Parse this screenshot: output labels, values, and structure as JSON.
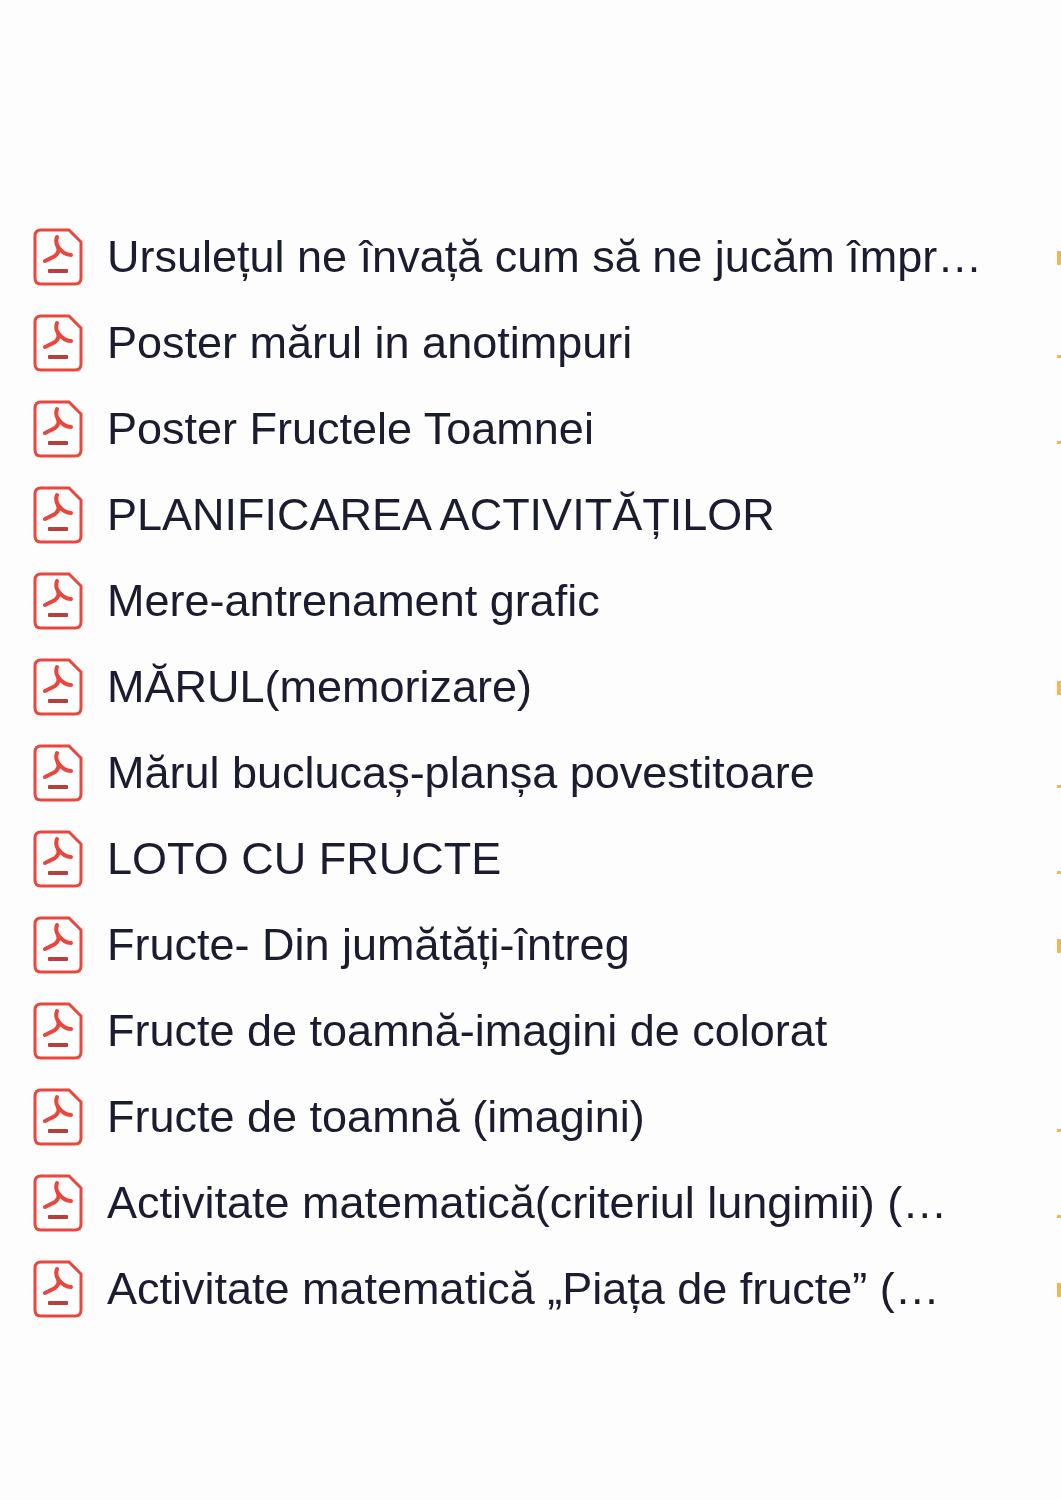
{
  "files": [
    {
      "name": "Ursulețul ne învață cum să ne jucăm împr…",
      "edge_mark": {
        "kind": "bar"
      }
    },
    {
      "name": "Poster mărul in anotimpuri",
      "edge_mark": {
        "kind": "dash"
      }
    },
    {
      "name": "Poster Fructele Toamnei",
      "edge_mark": {
        "kind": "dash"
      }
    },
    {
      "name": "PLANIFICAREA ACTIVITĂȚILOR"
    },
    {
      "name": "Mere-antrenament grafic"
    },
    {
      "name": "MĂRUL(memorizare)",
      "edge_mark": {
        "kind": "bar"
      }
    },
    {
      "name": "Mărul buclucaș-planșa povestitoare",
      "edge_mark": {
        "kind": "dash"
      }
    },
    {
      "name": "LOTO CU FRUCTE",
      "edge_mark": {
        "kind": "dash"
      }
    },
    {
      "name": "Fructe- Din jumătăți-întreg",
      "edge_mark": {
        "kind": "bar"
      }
    },
    {
      "name": "Fructe de toamnă-imagini de colorat"
    },
    {
      "name": "Fructe de toamnă (imagini)",
      "edge_mark": {
        "kind": "dash"
      }
    },
    {
      "name": "Activitate matematică(criteriul lungimii) (…",
      "edge_mark": {
        "kind": "dash"
      }
    },
    {
      "name": "Activitate matematică „Piața de fructe” (…",
      "edge_mark": {
        "kind": "bar"
      }
    }
  ]
}
